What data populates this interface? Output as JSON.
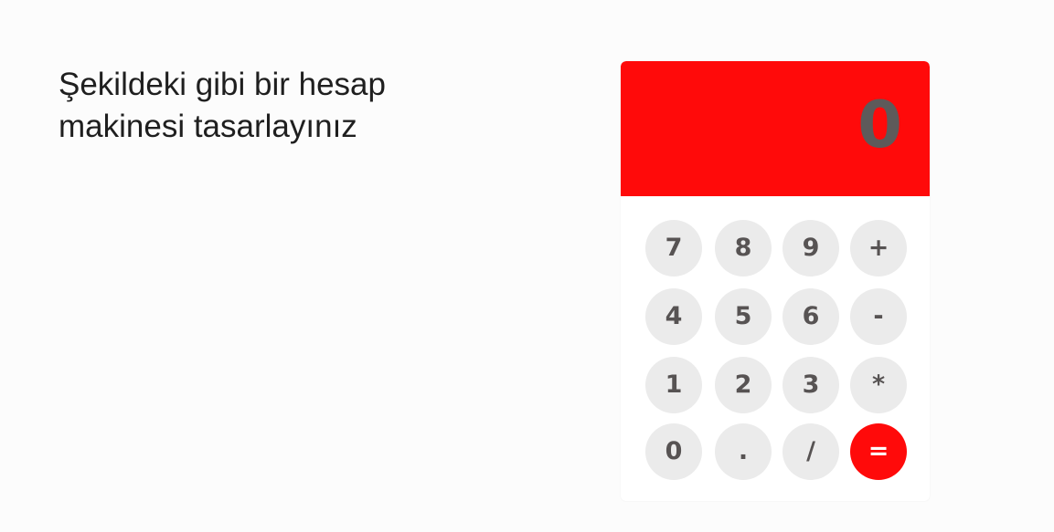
{
  "instruction": {
    "line1": "Şekildeki gibi bir hesap",
    "line2": "makinesi tasarlayınız"
  },
  "calculator": {
    "display_value": "0",
    "accent_color": "#ff0a0a",
    "key_color": "#ebebeb",
    "keys": {
      "k7": "7",
      "k8": "8",
      "k9": "9",
      "plus": "+",
      "k4": "4",
      "k5": "5",
      "k6": "6",
      "minus": "-",
      "k1": "1",
      "k2": "2",
      "k3": "3",
      "multiply": "*",
      "k0": "0",
      "decimal": ".",
      "divide": "/",
      "equals": "="
    }
  }
}
